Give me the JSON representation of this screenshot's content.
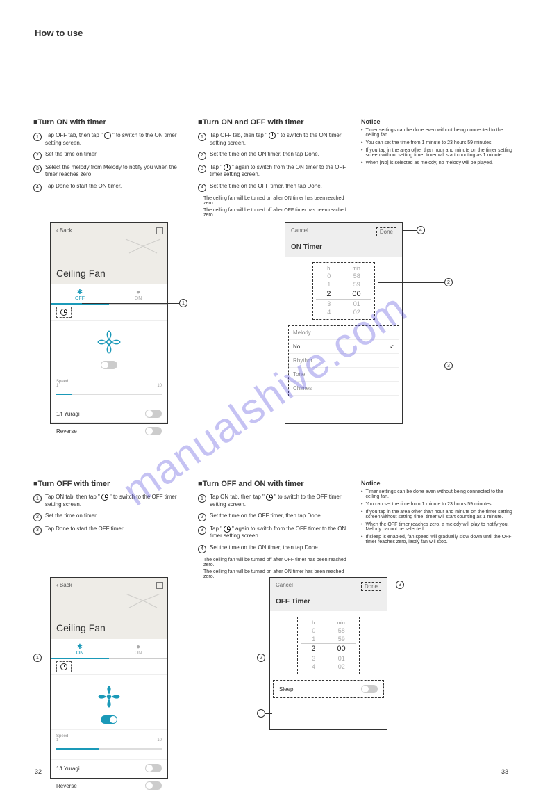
{
  "page_title": "How to use",
  "watermark": "manualshive.com",
  "footer": {
    "left": "32",
    "right": "33"
  },
  "sections": {
    "on_instructions": {
      "title": "■Turn ON with timer",
      "steps": [
        "Tap OFF tab, then tap \" \" to switch to the ON timer setting screen.",
        "Set the time on timer.",
        "Select the melody from Melody to notify you when the timer reaches zero.",
        "Tap Done to start the ON timer."
      ]
    },
    "on_off_instructions": {
      "title": "■Turn ON and OFF with timer",
      "steps": [
        "Tap OFF tab, then tap \" \" to switch to the ON timer setting screen.",
        "Set the time on the ON timer, then tap Done.",
        "Tap \" \" again to switch from the ON timer to the OFF timer setting screen.",
        "Set the time on the OFF timer, then tap Done."
      ],
      "notes": [
        "The ceiling fan will be turned on after ON timer has been reached zero.",
        "The ceiling fan will be turned off after OFF timer has been reached zero."
      ]
    },
    "on_notes": {
      "items": [
        "Timer settings can be done even without being connected to the ceiling fan.",
        "You can set the time from 1 minute to 23 hours 59 minutes.",
        "If you tap in the area other than hour and minute on the timer setting screen without setting time, timer will start counting as 1 minute.",
        "When [No] is selected as melody, no melody will be played."
      ]
    },
    "off_instructions": {
      "title": "■Turn OFF with timer",
      "steps": [
        "Tap ON tab, then tap \" \" to switch to the OFF timer setting screen.",
        "Set the time on timer.",
        "Tap Done to start the OFF timer."
      ]
    },
    "off_on_instructions": {
      "title": "■Turn OFF and ON with timer",
      "steps": [
        "Tap ON tab, then tap \" \" to switch to the OFF timer setting screen.",
        "Set the time on the OFF timer, then tap Done.",
        "Tap \" \" again to switch from the OFF timer to the ON timer setting screen.",
        "Set the time on the ON timer, then tap Done."
      ],
      "notes": [
        "The ceiling fan will be turned off after OFF timer has been reached zero.",
        "The ceiling fan will be turned on after ON timer has been reached zero."
      ]
    },
    "off_notes": {
      "items": [
        "Timer settings can be done even without being connected to the ceiling fan.",
        "You can set the time from 1 minute to 23 hours 59 minutes.",
        "If you tap in the area other than hour and minute on the timer setting screen without setting time, timer will start counting as 1 minute.",
        "When the OFF timer reaches zero, a melody will play to notify you. Melody cannot be selected.",
        "If sleep is enabled, fan speed will gradually slow down until the OFF timer reaches zero, lastly fan will stop."
      ]
    }
  },
  "phone_off": {
    "back": "Back",
    "title": "Ceiling Fan",
    "tab_off": "OFF",
    "tab_on": "ON",
    "speed_label": "Speed",
    "speed_min": "1",
    "speed_max": "10",
    "yuragi": "1/f Yuragi",
    "reverse": "Reverse"
  },
  "phone_on_timer": {
    "cancel": "Cancel",
    "done": "Done",
    "title": "ON Timer",
    "h": "h",
    "min": "min",
    "picker": [
      [
        "0",
        "58"
      ],
      [
        "1",
        "59"
      ],
      [
        "2",
        "00"
      ],
      [
        "3",
        "01"
      ],
      [
        "4",
        "02"
      ]
    ],
    "melody_label": "Melody",
    "melody_options": [
      "No",
      "Rhythm",
      "Tone",
      "Chimes"
    ]
  },
  "phone_on": {
    "back": "Back",
    "title": "Ceiling Fan",
    "tab_off": "ON",
    "tab_on": "ON",
    "speed_label": "Speed",
    "speed_min": "1",
    "speed_max": "10",
    "yuragi": "1/f Yuragi",
    "reverse": "Reverse"
  },
  "phone_off_timer": {
    "cancel": "Cancel",
    "done": "Done",
    "title": "OFF Timer",
    "h": "h",
    "min": "min",
    "picker": [
      [
        "0",
        "58"
      ],
      [
        "1",
        "59"
      ],
      [
        "2",
        "00"
      ],
      [
        "3",
        "01"
      ],
      [
        "4",
        "02"
      ]
    ],
    "sleep": "Sleep"
  }
}
